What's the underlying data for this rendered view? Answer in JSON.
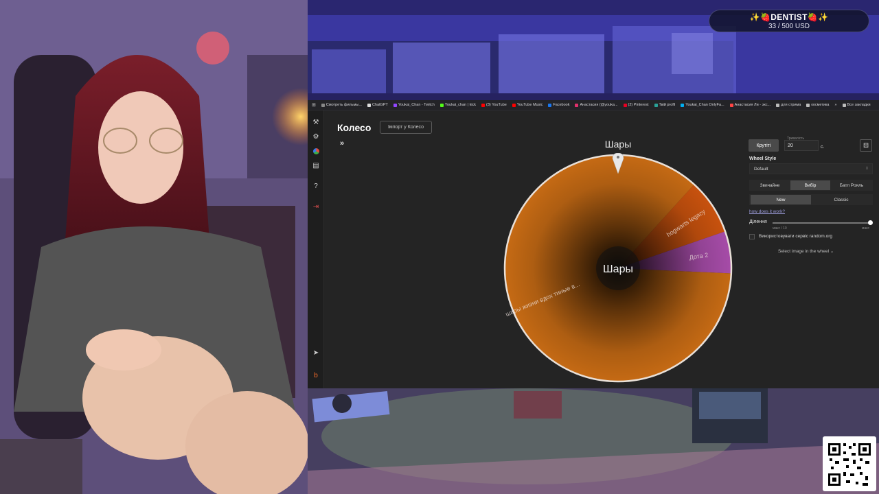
{
  "goal": {
    "title": "✨🍓DENTIST🍓✨",
    "amount": "33 / 500 USD"
  },
  "bookmarks": [
    {
      "label": "Смотреть фильмы...",
      "color": "#888888"
    },
    {
      "label": "ChatGPT",
      "color": "#dddddd"
    },
    {
      "label": "Youkai_Chan - Twitch",
      "color": "#9146ff"
    },
    {
      "label": "Youkai_chan | kick",
      "color": "#53fc18"
    },
    {
      "label": "(3) YouTube",
      "color": "#ff0000"
    },
    {
      "label": "YouTube Music",
      "color": "#ff0000"
    },
    {
      "label": "Facebook",
      "color": "#1877f2"
    },
    {
      "label": "Анастасия (@youka...",
      "color": "#e1306c"
    },
    {
      "label": "(2) Pinterest",
      "color": "#e60023"
    },
    {
      "label": "Твій profil",
      "color": "#2aa198"
    },
    {
      "label": "Youkai_Chan OnlyFa...",
      "color": "#00aff0"
    },
    {
      "label": "Анастасия Ли - экс...",
      "color": "#ff4444"
    },
    {
      "label": "для стрима",
      "color": "#bbbbbb"
    },
    {
      "label": "косметика",
      "color": "#bbbbbb"
    },
    {
      "label": "Все закладки",
      "color": "#bbbbbb"
    }
  ],
  "app": {
    "title": "Колесо",
    "import_label": "Імпорт у Колесо",
    "expand_symbol": "»",
    "winner": "Шары"
  },
  "wheel": {
    "center_label": "Шары",
    "segments": [
      {
        "label": "шары жизни вдох тиные в...",
        "percent": 86,
        "color": "#c56a14"
      },
      {
        "label": "hogwarts legacy",
        "percent": 8,
        "color": "#c8520e"
      },
      {
        "label": "Дота 2",
        "percent": 6,
        "color": "#a64ca8"
      }
    ]
  },
  "controls": {
    "spin_label": "Крутіті",
    "duration_label": "Тривалість",
    "duration_value": "20",
    "duration_unit": "с.",
    "wheel_style_label": "Wheel Style",
    "wheel_style_value": "Default",
    "modes": [
      "Звичайне",
      "Вибір",
      "Батл Рояль"
    ],
    "active_mode": 1,
    "variants": [
      "New",
      "Classic"
    ],
    "active_variant": 0,
    "how_link": "how does it work?",
    "division_label": "Ділення",
    "slider_min": "макс / 10",
    "slider_max": "макс",
    "slider_value": 1.0,
    "random_org_label": "Використовувати сервіс random.org",
    "select_image_label": "Select image in the wheel"
  }
}
